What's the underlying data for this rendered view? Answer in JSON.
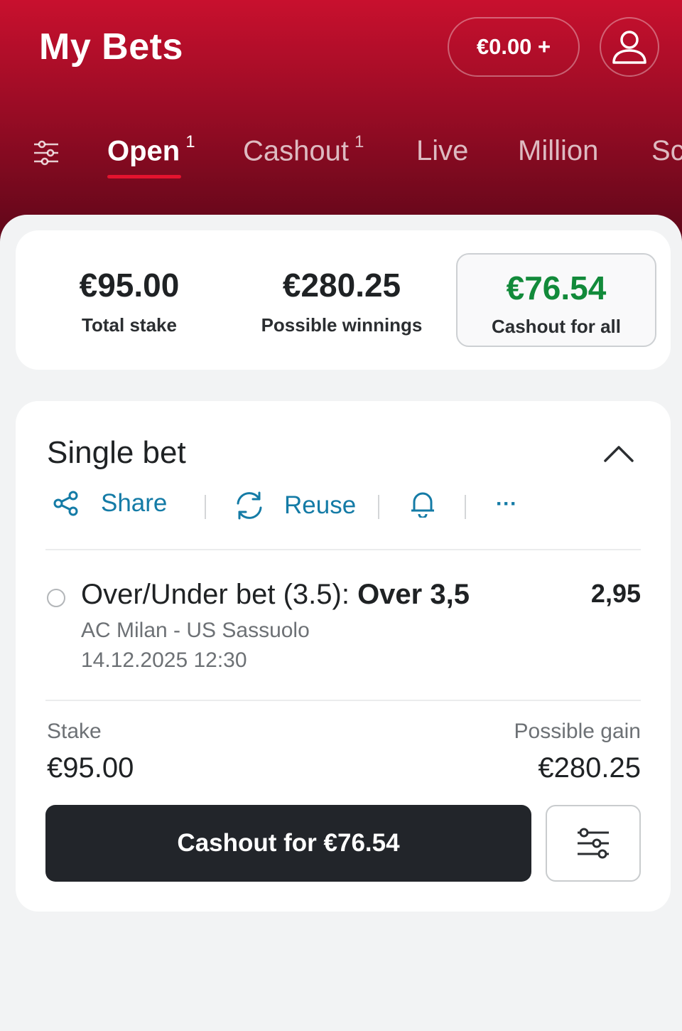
{
  "header": {
    "title": "My Bets",
    "balance": "€0.00 +",
    "profile_icon": "user-icon",
    "accent": "#c8102e"
  },
  "tabs": [
    {
      "label": "Open",
      "count": "1",
      "active": true
    },
    {
      "label": "Cashout",
      "count": "1",
      "active": false
    },
    {
      "label": "Live",
      "count": "",
      "active": false
    },
    {
      "label": "Million",
      "count": "",
      "active": false
    },
    {
      "label": "Sc",
      "count": "",
      "active": false
    }
  ],
  "summary": {
    "total_stake_value": "€95.00",
    "total_stake_label": "Total stake",
    "possible_winnings_value": "€280.25",
    "possible_winnings_label": "Possible winnings",
    "cashout_all_value": "€76.54",
    "cashout_all_label": "Cashout for all",
    "cashout_color": "#128a3a"
  },
  "bet": {
    "type": "Single bet",
    "actions": {
      "share": "Share",
      "reuse": "Reuse",
      "more": "···"
    },
    "selection": {
      "market": "Over/Under bet (3.5):",
      "pick": "Over 3,5",
      "odds": "2,95",
      "event": "AC Milan - US Sassuolo",
      "date": "14.12.2025 12:30"
    },
    "stake_label": "Stake",
    "stake_value": "€95.00",
    "gain_label": "Possible gain",
    "gain_value": "€280.25",
    "cashout_button": "Cashout for €76.54",
    "link_color": "#147ba6"
  }
}
